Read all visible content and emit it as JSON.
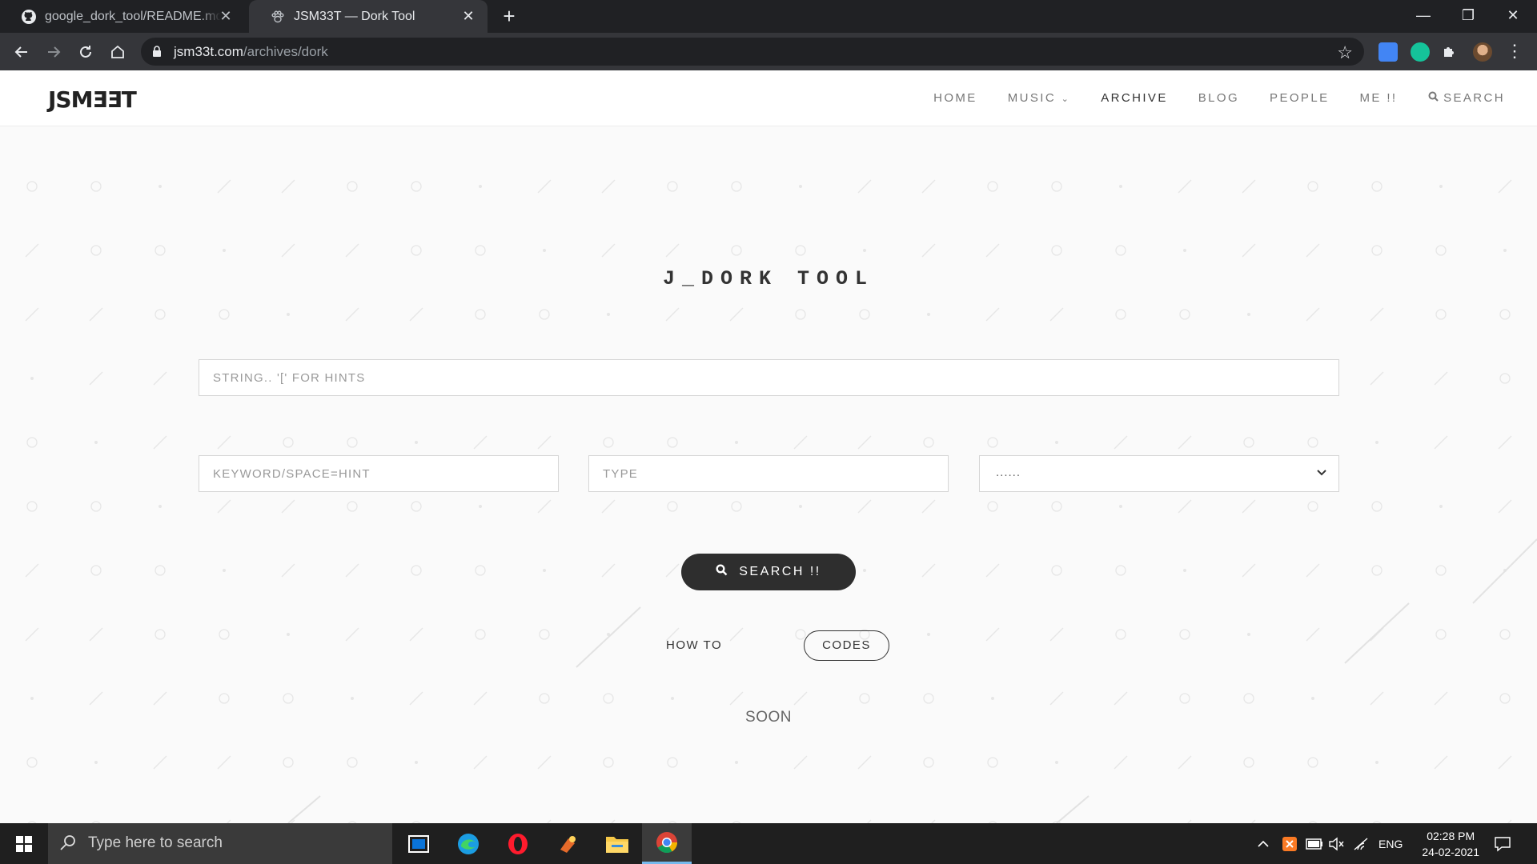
{
  "browser": {
    "tabs": [
      {
        "title": "google_dork_tool/README.md a",
        "icon": "github-icon"
      },
      {
        "title": "JSM33T — Dork Tool",
        "icon": "paw-icon",
        "active": true
      }
    ],
    "url_host": "jsm33t.com",
    "url_path": "/archives/dork"
  },
  "site": {
    "logo": "JSMƎƎT",
    "nav": [
      {
        "label": "HOME"
      },
      {
        "label": "MUSIC"
      },
      {
        "label": "ARCHIVE",
        "active": true
      },
      {
        "label": "BLOG"
      },
      {
        "label": "PEOPLE"
      },
      {
        "label": "ME !!"
      },
      {
        "label": "SEARCH"
      }
    ]
  },
  "main": {
    "title": "J_DORK TOOL",
    "string_placeholder": "STRING.. '[' FOR HINTS",
    "keyword_placeholder": "KEYWORD/SPACE=HINT",
    "type_placeholder": "TYPE",
    "select_value": "......",
    "search_label": "SEARCH !!",
    "how_to_label": "HOW TO",
    "codes_label": "CODES",
    "soon_text": "SOON"
  },
  "taskbar": {
    "search_placeholder": "Type here to search",
    "language": "ENG",
    "time": "02:28 PM",
    "date": "24-02-2021"
  },
  "colors": {
    "accent_dark": "#2e2e2e",
    "chrome_bg": "#35363a"
  }
}
